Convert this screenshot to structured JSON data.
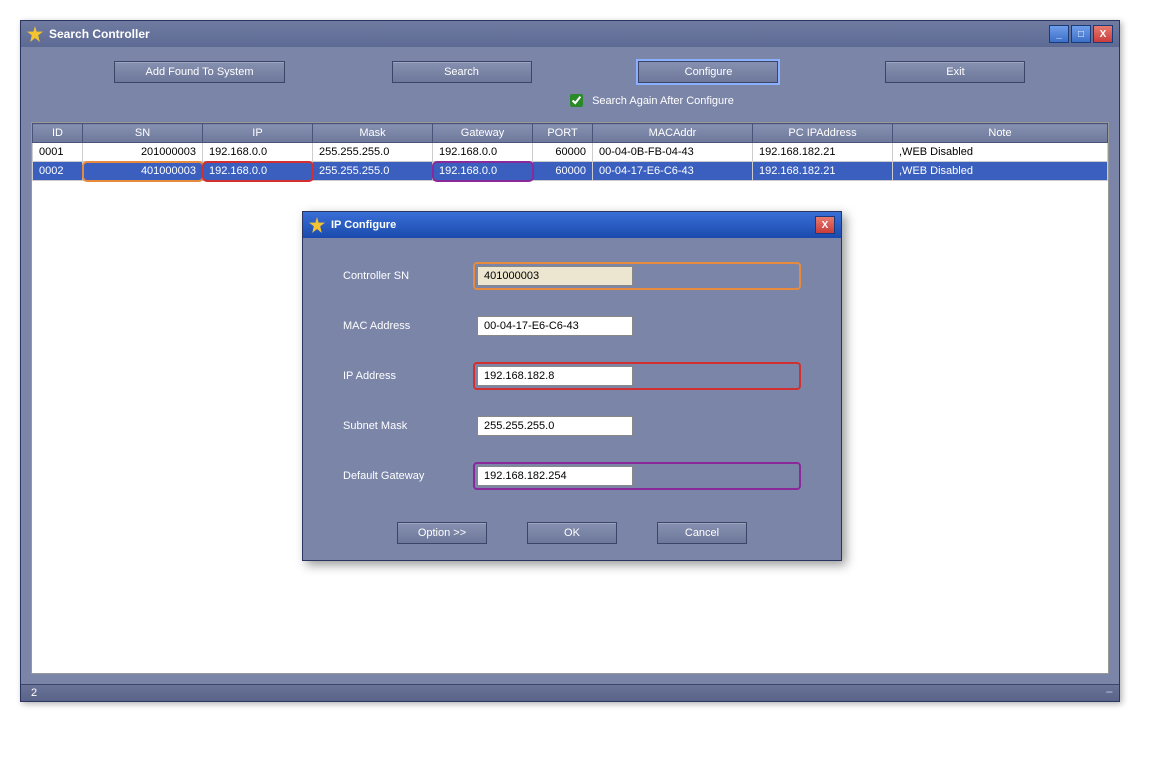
{
  "window": {
    "title": "Search Controller",
    "min_label": "_",
    "max_label": "□",
    "close_label": "X"
  },
  "toolbar": {
    "add_found": "Add Found To System",
    "search": "Search",
    "configure": "Configure",
    "exit": "Exit",
    "again_label": "Search Again After Configure",
    "again_checked": true
  },
  "table": {
    "headers": {
      "id": "ID",
      "sn": "SN",
      "ip": "IP",
      "mask": "Mask",
      "gateway": "Gateway",
      "port": "PORT",
      "mac": "MACAddr",
      "pcip": "PC IPAddress",
      "note": "Note"
    },
    "rows": [
      {
        "id": "0001",
        "sn": "201000003",
        "ip": "192.168.0.0",
        "mask": "255.255.255.0",
        "gateway": "192.168.0.0",
        "port": "60000",
        "mac": "00-04-0B-FB-04-43",
        "pcip": "192.168.182.21",
        "note": ",WEB Disabled",
        "selected": false
      },
      {
        "id": "0002",
        "sn": "401000003",
        "ip": "192.168.0.0",
        "mask": "255.255.255.0",
        "gateway": "192.168.0.0",
        "port": "60000",
        "mac": "00-04-17-E6-C6-43",
        "pcip": "192.168.182.21",
        "note": ",WEB Disabled",
        "selected": true
      }
    ]
  },
  "dialog": {
    "title": "IP Configure",
    "close_label": "X",
    "labels": {
      "sn": "Controller SN",
      "mac": "MAC Address",
      "ip": "IP Address",
      "mask": "Subnet Mask",
      "gateway": "Default Gateway"
    },
    "values": {
      "sn": "401000003",
      "mac": "00-04-17-E6-C6-43",
      "ip": "192.168.182.8",
      "mask": "255.255.255.0",
      "gateway": "192.168.182.254"
    },
    "buttons": {
      "option": "Option >>",
      "ok": "OK",
      "cancel": "Cancel"
    }
  },
  "statusbar": {
    "count": "2",
    "grip": "----"
  },
  "annotation_colors": {
    "sn": "#e88a3c",
    "ip": "#d23030",
    "gateway": "#8a2a9a"
  }
}
